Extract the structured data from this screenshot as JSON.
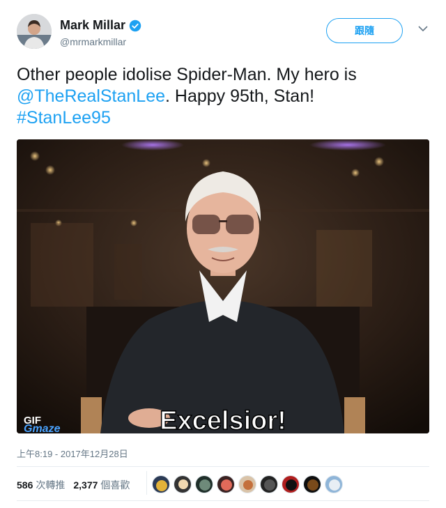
{
  "author": {
    "name": "Mark Millar",
    "handle": "@mrmarkmillar",
    "verified": true,
    "follow_label": "跟隨"
  },
  "tweet": {
    "text_part1": "Other people idolise Spider-Man. My hero is ",
    "mention": "@TheRealStanLee",
    "text_part2": ". Happy 95th, Stan! ",
    "hashtag": "#StanLee95"
  },
  "media": {
    "gif_badge": "GIF",
    "watermark": "Gmaze",
    "caption": "Excelsior!"
  },
  "timestamp": "上午8:19 - 2017年12月28日",
  "stats": {
    "retweets_count": "586",
    "retweets_label": "次轉推",
    "likes_count": "2,377",
    "likes_label": "個喜歡"
  },
  "liker_avatars": [
    "liker-1",
    "liker-2",
    "liker-3",
    "liker-4",
    "liker-5",
    "liker-6",
    "liker-7",
    "liker-8",
    "liker-9"
  ],
  "colors": {
    "accent": "#1da1f2",
    "text": "#14171a",
    "muted": "#657786",
    "divider": "#e6ecf0"
  }
}
